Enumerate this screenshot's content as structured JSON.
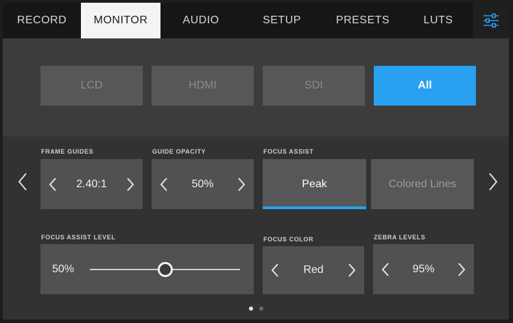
{
  "tabs": [
    {
      "label": "RECORD",
      "active": false
    },
    {
      "label": "MONITOR",
      "active": true
    },
    {
      "label": "AUDIO",
      "active": false
    },
    {
      "label": "SETUP",
      "active": false
    },
    {
      "label": "PRESETS",
      "active": false
    },
    {
      "label": "LUTS",
      "active": false
    }
  ],
  "settings_icon": "sliders-icon",
  "outputs": [
    {
      "label": "LCD",
      "active": false
    },
    {
      "label": "HDMI",
      "active": false
    },
    {
      "label": "SDI",
      "active": false
    },
    {
      "label": "All",
      "active": true
    }
  ],
  "frame_guides": {
    "label": "FRAME GUIDES",
    "value": "2.40:1"
  },
  "guide_opacity": {
    "label": "GUIDE OPACITY",
    "value": "50%"
  },
  "focus_assist": {
    "label": "FOCUS ASSIST",
    "options": [
      "Peak",
      "Colored Lines"
    ],
    "selected": "Peak"
  },
  "focus_assist_level": {
    "label": "FOCUS ASSIST LEVEL",
    "value": "50%",
    "fraction": 0.5
  },
  "focus_color": {
    "label": "FOCUS COLOR",
    "value": "Red"
  },
  "zebra_levels": {
    "label": "ZEBRA LEVELS",
    "value": "95%"
  },
  "pagination": {
    "pages": 2,
    "current": 1
  },
  "colors": {
    "accent": "#27a1f0",
    "tab_active_bg": "#f4f4f4",
    "tabbar_bg": "#161616"
  }
}
